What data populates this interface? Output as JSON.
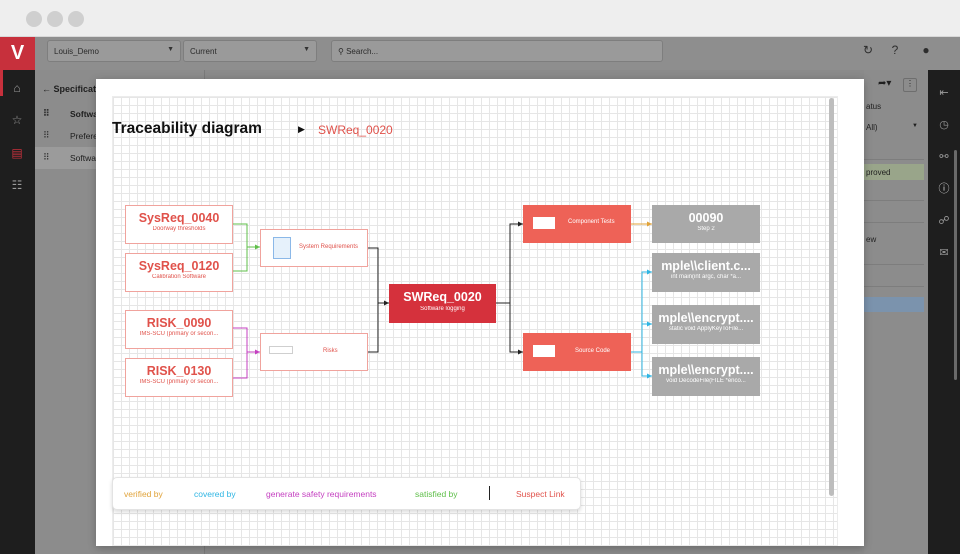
{
  "app": {
    "project_select": "Louis_Demo",
    "version_select": "Current",
    "search_placeholder": "Search...",
    "logo_letter": "V"
  },
  "background": {
    "panel_title": "Specificat",
    "rows": [
      {
        "label": "Softwa",
        "bold": true
      },
      {
        "label": "Prefere",
        "bold": false
      },
      {
        "label": "Softwa",
        "bold": false
      }
    ],
    "right_panel": {
      "status_label": "atus",
      "status_value": "All)",
      "approved_label": "proved",
      "view_label": "ew"
    }
  },
  "diagram": {
    "title": "Traceability diagram",
    "requirement": "SWReq_0020",
    "nodes": {
      "sysreq_0040": {
        "title": "SysReq_0040",
        "subtitle": "Doorway thresholds"
      },
      "sysreq_0120": {
        "title": "SysReq_0120",
        "subtitle": "Calibration Software"
      },
      "risk_0090": {
        "title": "RISK_0090",
        "subtitle": "IMS-SCU (primary or secon..."
      },
      "risk_0130": {
        "title": "RISK_0130",
        "subtitle": "IMS-SCU (primary or secon..."
      },
      "system_requirements": {
        "label": "System Requirements"
      },
      "risks": {
        "label": "Risks"
      },
      "swreq_0020": {
        "title": "SWReq_0020",
        "subtitle": "Software logging"
      },
      "component_tests": {
        "label": "Component Tests"
      },
      "source_code": {
        "label": "Source Code"
      },
      "test_00090": {
        "title": "00090",
        "subtitle": "Step 2"
      },
      "client_c": {
        "title": "mple\\\\client.c...",
        "subtitle": "int main(int argc, char *a..."
      },
      "encrypt_1": {
        "title": "mple\\\\encrypt....",
        "subtitle": "static void ApplyKeyToFile..."
      },
      "encrypt_2": {
        "title": "mple\\\\encrypt....",
        "subtitle": "void DecodeFile(FILE *enco..."
      }
    }
  },
  "legend": {
    "verified_by": "verified by",
    "covered_by": "covered by",
    "generate_safety": "generate safety requirements",
    "satisfied_by": "satisfied by",
    "suspect_link": "Suspect Link"
  },
  "colors": {
    "brand": "#c7303c",
    "verified": "#e0a33a",
    "covered": "#2fb5e3",
    "generate_safety": "#c43fc0",
    "satisfied": "#5fbf4a",
    "suspect": "#e0524b",
    "node_outline": "#e0524b",
    "node_fill": "#ee6257",
    "node_main": "#d5313c",
    "node_gray": "#a9a9a9"
  }
}
